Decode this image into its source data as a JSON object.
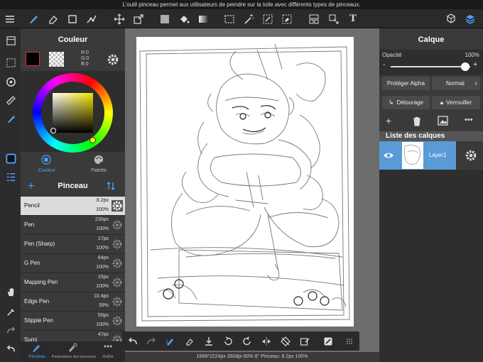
{
  "status": {
    "message": "L'outil pinceau permet aux utilisateurs de peindre sur la toile avec différents types de pinceaux."
  },
  "color_panel": {
    "title": "Couleur",
    "r": "R:0",
    "g": "G:0",
    "b": "B:0",
    "tab_color": "Couleur",
    "tab_palette": "Palette",
    "current_color": "#000000"
  },
  "brush_panel": {
    "title": "Pinceau",
    "items": [
      {
        "name": "Pencil",
        "size": "8.2px",
        "opacity": "100%"
      },
      {
        "name": "Pen",
        "size": "230px",
        "opacity": "100%"
      },
      {
        "name": "Pen (Sharp)",
        "size": "17px",
        "opacity": "100%"
      },
      {
        "name": "G Pen",
        "size": "64px",
        "opacity": "100%"
      },
      {
        "name": "Mapping Pen",
        "size": "15px",
        "opacity": "100%"
      },
      {
        "name": "Edge Pen",
        "size": "10.4px",
        "opacity": "39%"
      },
      {
        "name": "Stipple Pen",
        "size": "50px",
        "opacity": "100%"
      },
      {
        "name": "Sumi",
        "size": "47px",
        "opacity": ""
      }
    ],
    "tabs": {
      "brush": "Pinceau",
      "params": "Paramètres des pinceaux",
      "other": "Autre"
    }
  },
  "layer_panel": {
    "title": "Calque",
    "opacity_label": "Opacité",
    "opacity_value": "100%",
    "opacity_level": 1.0,
    "protect_alpha": "Protéger Alpha",
    "blend_mode": "Normal",
    "clipping": "Détourage",
    "lock": "Verrouiller",
    "list_title": "Liste des calques",
    "layers": [
      {
        "name": "Layer1"
      }
    ]
  },
  "footer": {
    "info": "1668*2224px 350dpi 60% 8° Pinceau: 8.2px 100%"
  },
  "colors": {
    "accent": "#4a90d9",
    "selected_row": "#dcdcdc"
  }
}
